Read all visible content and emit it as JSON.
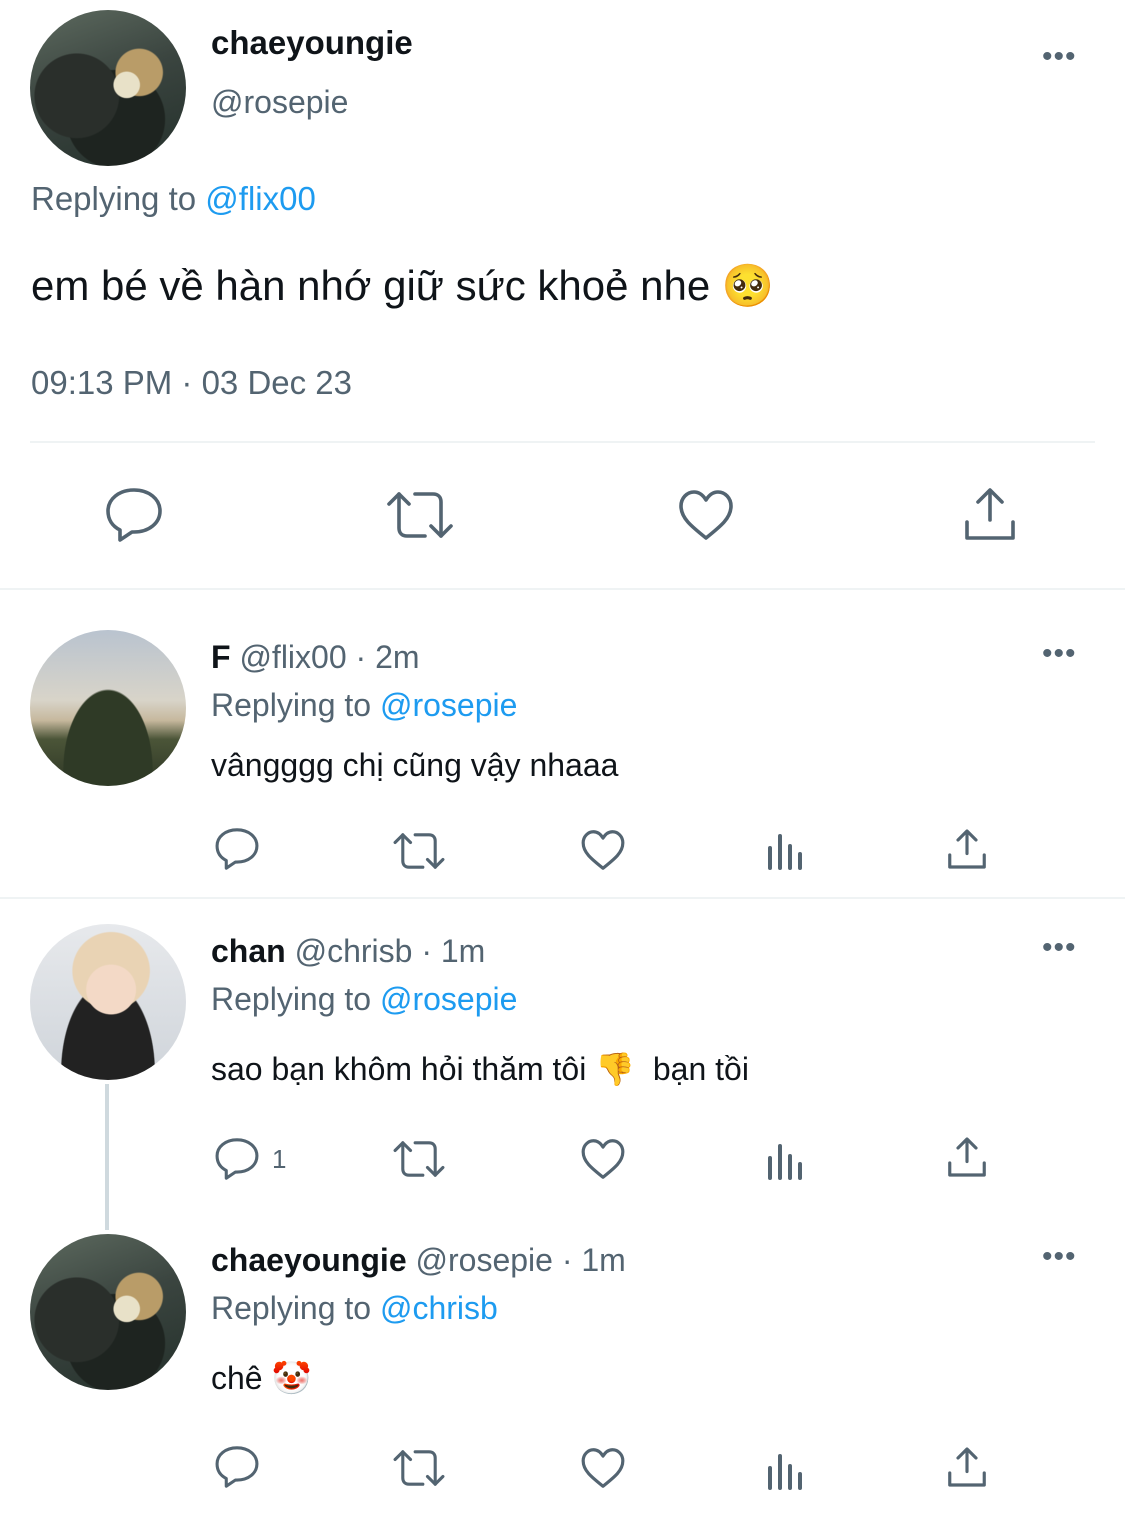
{
  "main_tweet": {
    "display_name": "chaeyoungie",
    "handle": "@rosepie",
    "replying_prefix": "Replying to",
    "replying_to": "@flix00",
    "text": "em bé về hàn nhớ giữ sức khoẻ nhe 🥺",
    "timestamp": "09:13 PM · 03 Dec 23",
    "more_icon": "more-icon"
  },
  "replies": [
    {
      "display_name": "F",
      "handle": "@flix00",
      "time": "· 2m",
      "replying_prefix": "Replying to",
      "replying_to": "@rosepie",
      "text": "vângggg chị cũng vậy nhaaa",
      "reply_count": ""
    },
    {
      "display_name": "chan",
      "handle": "@chrisb",
      "time": "· 1m",
      "replying_prefix": "Replying to",
      "replying_to": "@rosepie",
      "text": "sao bạn khôm hỏi thăm tôi 👎  bạn tồi",
      "reply_count": "1"
    },
    {
      "display_name": "chaeyoungie",
      "handle": "@rosepie",
      "time": "· 1m",
      "replying_prefix": "Replying to",
      "replying_to": "@chrisb",
      "text": "chê 🤡",
      "reply_count": ""
    }
  ],
  "colors": {
    "link": "#1d9bf0",
    "secondary_text": "#536471",
    "icon": "#536471",
    "divider": "#eff3f4"
  }
}
